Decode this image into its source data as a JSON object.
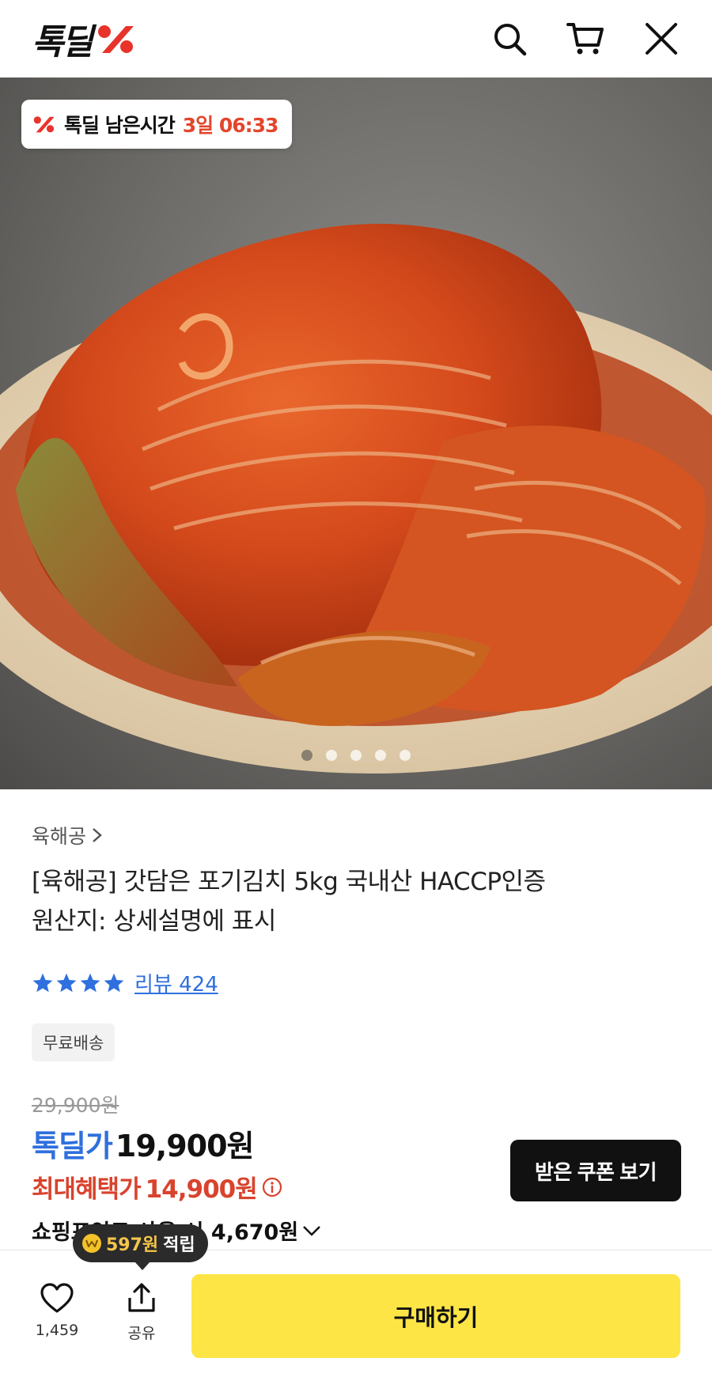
{
  "header": {
    "logo_text": "톡딜",
    "icons": [
      "search-icon",
      "cart-icon",
      "close-icon"
    ]
  },
  "hero": {
    "timer_label": "톡딜 남은시간",
    "timer_value": "3일 06:33",
    "dots_total": 5,
    "dots_active_index": 0
  },
  "product": {
    "brand": "육해공",
    "title_line1": "[육해공] 갓담은 포기김치 5kg 국내산 HACCP인증",
    "title_line2": "원산지: 상세설명에 표시",
    "rating_stars": 4,
    "review_label": "리뷰 424",
    "badge": "무료배송",
    "original_price": "29,900원",
    "deal_label": "톡딜가",
    "deal_price": "19,900원",
    "max_label": "최대혜택가",
    "max_price": "14,900원",
    "coupon_button": "받은 쿠폰 보기",
    "point_text": "쇼핑포인트 사용 시 4,670원"
  },
  "tooltip": {
    "amount": "597원",
    "suffix": "적립"
  },
  "bottom": {
    "like_count": "1,459",
    "share_label": "공유",
    "buy_label": "구매하기"
  },
  "colors": {
    "accent_blue": "#2f6fde",
    "accent_red": "#e3452b",
    "buy_yellow": "#fde546",
    "logo_red": "#e8332b"
  }
}
